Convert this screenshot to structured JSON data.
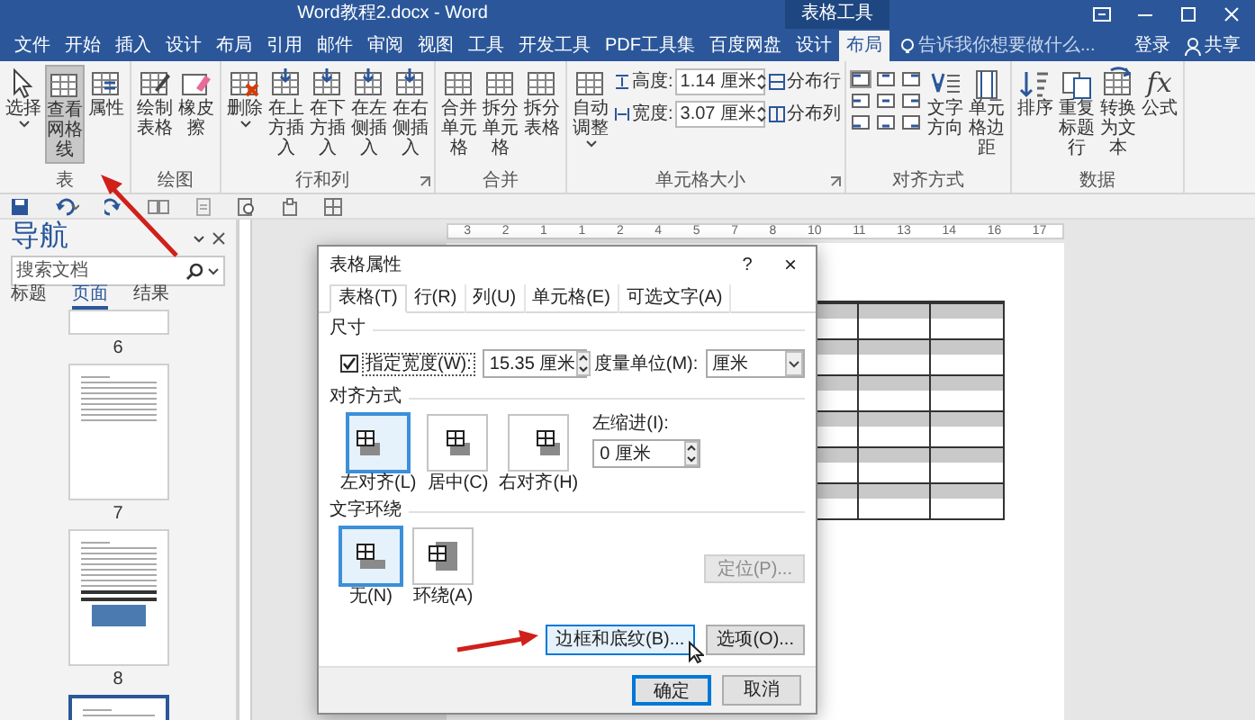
{
  "window": {
    "title": "Word教程2.docx - Word",
    "context_tab": "表格工具"
  },
  "tabs": [
    {
      "label": "文件",
      "selected": false
    },
    {
      "label": "开始",
      "selected": false
    },
    {
      "label": "插入",
      "selected": false
    },
    {
      "label": "设计",
      "selected": false
    },
    {
      "label": "布局",
      "selected": false
    },
    {
      "label": "引用",
      "selected": false
    },
    {
      "label": "邮件",
      "selected": false
    },
    {
      "label": "审阅",
      "selected": false
    },
    {
      "label": "视图",
      "selected": false
    },
    {
      "label": "工具",
      "selected": false
    },
    {
      "label": "开发工具",
      "selected": false
    },
    {
      "label": "PDF工具集",
      "selected": false
    },
    {
      "label": "百度网盘",
      "selected": false
    },
    {
      "label": "设计",
      "selected": false
    },
    {
      "label": "布局",
      "selected": true
    }
  ],
  "tell_me": {
    "placeholder": "告诉我你想要做什么..."
  },
  "account": {
    "sign_in": "登录",
    "share": "共享"
  },
  "ribbon": {
    "groups": [
      {
        "label": "表",
        "launcher": false,
        "items": [
          {
            "kind": "large",
            "label": "选择",
            "on": false,
            "dropdown": true
          },
          {
            "kind": "large",
            "label": "查看网格线",
            "on": true,
            "dropdown": false
          },
          {
            "kind": "large",
            "label": "属性",
            "on": false,
            "dropdown": false
          }
        ]
      },
      {
        "label": "绘图",
        "launcher": false,
        "items": [
          {
            "kind": "large",
            "label": "绘制表格",
            "on": false,
            "dropdown": false
          },
          {
            "kind": "large",
            "label": "橡皮擦",
            "on": false,
            "dropdown": false
          }
        ]
      },
      {
        "label": "行和列",
        "launcher": true,
        "items": [
          {
            "kind": "large",
            "label": "删除",
            "on": false,
            "dropdown": true
          },
          {
            "kind": "large",
            "label": "在上方插入",
            "on": false,
            "dropdown": false
          },
          {
            "kind": "large",
            "label": "在下方插入",
            "on": false,
            "dropdown": false
          },
          {
            "kind": "large",
            "label": "在左侧插入",
            "on": false,
            "dropdown": false
          },
          {
            "kind": "large",
            "label": "在右侧插入",
            "on": false,
            "dropdown": false
          }
        ]
      },
      {
        "label": "合并",
        "launcher": false,
        "items": [
          {
            "kind": "large",
            "label": "合并单元格",
            "on": false,
            "dropdown": false
          },
          {
            "kind": "large",
            "label": "拆分单元格",
            "on": false,
            "dropdown": false
          },
          {
            "kind": "large",
            "label": "拆分表格",
            "on": false,
            "dropdown": false
          }
        ]
      },
      {
        "label": "单元格大小",
        "launcher": true,
        "items": [
          {
            "kind": "large",
            "label": "自动调整",
            "on": false,
            "dropdown": true
          },
          {
            "kind": "fields",
            "rows": [
              {
                "label": "高度:",
                "value": "1.14 厘米"
              },
              {
                "label": "宽度:",
                "value": "3.07 厘米"
              }
            ]
          },
          {
            "kind": "small",
            "rows": [
              "分布行",
              "分布列"
            ]
          }
        ]
      },
      {
        "label": "对齐方式",
        "launcher": false,
        "items": [
          {
            "kind": "align_grid",
            "cells": [
              {
                "selected": true
              },
              {
                "selected": false
              },
              {
                "selected": false
              },
              {
                "selected": false
              },
              {
                "selected": false
              },
              {
                "selected": false
              },
              {
                "selected": false
              },
              {
                "selected": false
              },
              {
                "selected": false
              }
            ]
          },
          {
            "kind": "large",
            "label": "文字方向",
            "on": false,
            "dropdown": false
          },
          {
            "kind": "large",
            "label": "单元格边距",
            "on": false,
            "dropdown": false
          }
        ]
      },
      {
        "label": "数据",
        "launcher": false,
        "items": [
          {
            "kind": "large",
            "label": "排序",
            "on": false,
            "dropdown": false
          },
          {
            "kind": "large",
            "label": "重复标题行",
            "on": false,
            "dropdown": false
          },
          {
            "kind": "large",
            "label": "转换为文本",
            "on": false,
            "dropdown": false
          },
          {
            "kind": "glyph",
            "glyph": "fx",
            "label": "公式"
          }
        ]
      }
    ]
  },
  "navigation": {
    "title": "导航",
    "search": {
      "placeholder": "搜索文档"
    },
    "tabs": [
      {
        "label": "标题",
        "selected": false
      },
      {
        "label": "页面",
        "selected": true
      },
      {
        "label": "结果",
        "selected": false
      }
    ],
    "pages": [
      {
        "number": "6",
        "selected": false
      },
      {
        "number": "7",
        "selected": false
      },
      {
        "number": "8",
        "selected": false
      },
      {
        "selected": true
      }
    ]
  },
  "ruler": {
    "labels": [
      "3",
      "2",
      "1",
      "1",
      "2",
      "4",
      "5",
      "7",
      "8",
      "10",
      "11",
      "13",
      "14",
      "16",
      "17"
    ]
  },
  "dialog": {
    "title": "表格属性",
    "help": "?",
    "close": "×",
    "tabs": [
      {
        "label": "表格(T)",
        "selected": true
      },
      {
        "label": "行(R)",
        "selected": false
      },
      {
        "label": "列(U)",
        "selected": false
      },
      {
        "label": "单元格(E)",
        "selected": false
      },
      {
        "label": "可选文字(A)",
        "selected": false
      }
    ],
    "size": {
      "heading": "尺寸",
      "width_checkbox": {
        "label": "指定宽度(W):",
        "checked": true
      },
      "width_value": "15.35 厘米",
      "unit_label": "度量单位(M):",
      "unit_value": "厘米"
    },
    "alignment": {
      "heading": "对齐方式",
      "options": [
        {
          "label": "左对齐(L)",
          "selected": true
        },
        {
          "label": "居中(C)",
          "selected": false
        },
        {
          "label": "右对齐(H)",
          "selected": false
        }
      ],
      "indent_label": "左缩进(I):",
      "indent_value": "0 厘米"
    },
    "wrapping": {
      "heading": "文字环绕",
      "options": [
        {
          "label": "无(N)",
          "selected": true
        },
        {
          "label": "环绕(A)",
          "selected": false
        }
      ],
      "positioning_button": {
        "label": "定位(P)...",
        "disabled": true
      }
    },
    "buttons": [
      {
        "label": "边框和底纹(B)...",
        "hovered": true
      },
      {
        "label": "选项(O)...",
        "hovered": false
      }
    ],
    "footer_buttons": [
      {
        "label": "确定",
        "default": true
      },
      {
        "label": "取消",
        "default": false
      }
    ]
  }
}
